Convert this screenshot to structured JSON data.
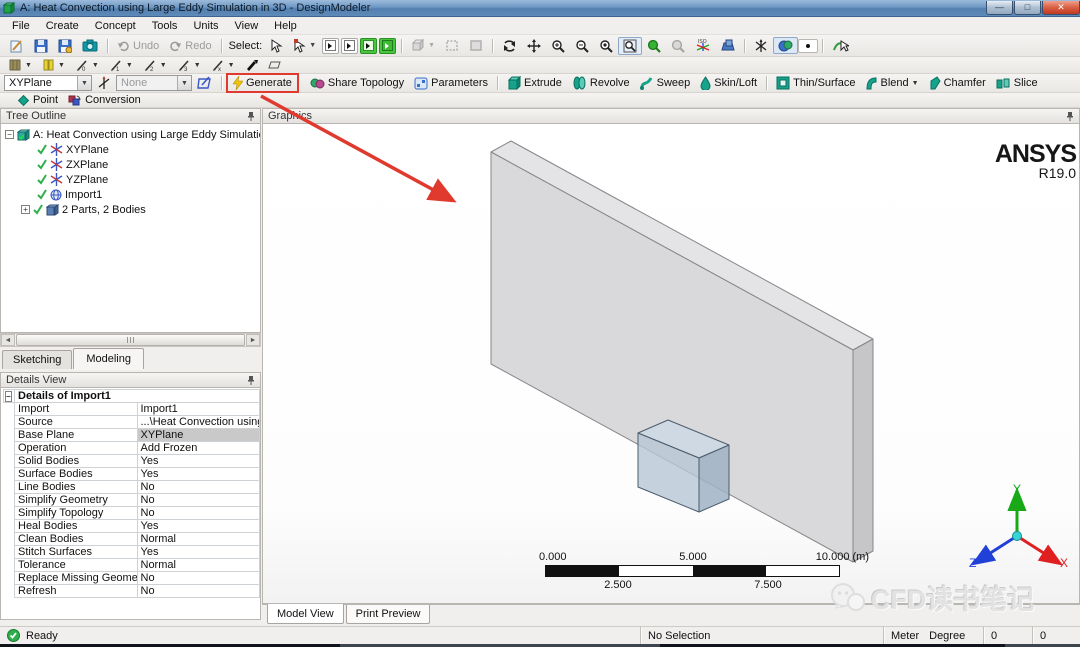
{
  "window": {
    "title": "A: Heat Convection using Large Eddy Simulation in 3D - DesignModeler",
    "controls": {
      "minimize": "—",
      "maximize": "□",
      "close": "✕"
    }
  },
  "menu": [
    "File",
    "Create",
    "Concept",
    "Tools",
    "Units",
    "View",
    "Help"
  ],
  "toolbars": {
    "select_label": "Select:",
    "undo": "Undo",
    "redo": "Redo",
    "iso_label": "ISO",
    "plane_select": "XYPlane",
    "sketch_select": "None",
    "generate": "Generate",
    "share_topology": "Share Topology",
    "parameters": "Parameters",
    "extrude": "Extrude",
    "revolve": "Revolve",
    "sweep": "Sweep",
    "skin_loft": "Skin/Loft",
    "thin_surface": "Thin/Surface",
    "blend": "Blend",
    "chamfer": "Chamfer",
    "slice": "Slice",
    "point": "Point",
    "conversion": "Conversion"
  },
  "tree": {
    "header": "Tree Outline",
    "root_label": "A: Heat Convection using Large Eddy Simulation ir",
    "items": [
      "XYPlane",
      "ZXPlane",
      "YZPlane",
      "Import1",
      "2 Parts, 2 Bodies"
    ]
  },
  "panel_tabs": {
    "sketching": "Sketching",
    "modeling": "Modeling"
  },
  "details": {
    "header": "Details View",
    "group_title": "Details of Import1",
    "rows": [
      {
        "label": "Import",
        "value": "Import1"
      },
      {
        "label": "Source",
        "value": "...\\Heat Convection using Large Ed"
      },
      {
        "label": "Base Plane",
        "value": "XYPlane"
      },
      {
        "label": "Operation",
        "value": "Add Frozen"
      },
      {
        "label": "Solid Bodies",
        "value": "Yes"
      },
      {
        "label": "Surface Bodies",
        "value": "Yes"
      },
      {
        "label": "Line Bodies",
        "value": "No"
      },
      {
        "label": "Simplify Geometry",
        "value": "No"
      },
      {
        "label": "Simplify Topology",
        "value": "No"
      },
      {
        "label": "Heal Bodies",
        "value": "Yes"
      },
      {
        "label": "Clean Bodies",
        "value": "Normal"
      },
      {
        "label": "Stitch Surfaces",
        "value": "Yes"
      },
      {
        "label": "Tolerance",
        "value": "Normal"
      },
      {
        "label": "Replace Missing Geometry",
        "value": "No"
      },
      {
        "label": "Refresh",
        "value": "No"
      }
    ]
  },
  "graphics": {
    "header": "Graphics",
    "logo_title": "ANSYS",
    "logo_version": "R19.0",
    "ruler": {
      "top_labels": [
        "0.000",
        "5.000",
        "10.000 (m)"
      ],
      "bottom_labels": [
        "2.500",
        "7.500"
      ]
    },
    "triad": {
      "x": "X",
      "y": "Y",
      "z": "Z"
    },
    "watermark": "CFD读书笔记"
  },
  "view_tabs": {
    "model_view": "Model View",
    "print_preview": "Print Preview"
  },
  "status": {
    "state": "Ready",
    "selection": "No Selection",
    "length_unit": "Meter",
    "angle_unit": "Degree",
    "counter1": "0",
    "counter2": "0"
  },
  "accent_colors": {
    "annotation_red": "#e0392e",
    "ansys_teal": "#0f9d8c",
    "check_green": "#2faf4b",
    "axis_x_red": "#e02020",
    "axis_y_green": "#18a818",
    "axis_z_blue": "#2040d8"
  },
  "icons": {
    "status_ok": "check-in-green-circle",
    "generate": "yellow-lightning-bolt",
    "tree_plane": "axis-star",
    "tree_body": "blue-cube"
  }
}
